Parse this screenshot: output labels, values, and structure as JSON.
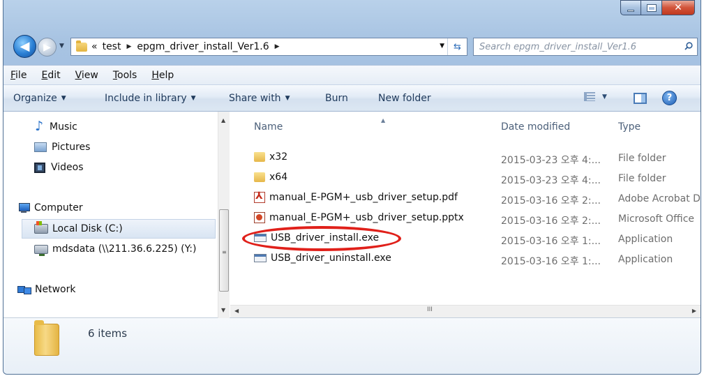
{
  "window": {
    "caption_minimize": "–",
    "caption_close": "✕"
  },
  "navigation": {
    "back_glyph": "◀",
    "forward_glyph": "▶",
    "address": {
      "overflow": "«",
      "crumbs": [
        "test",
        "epgm_driver_install_Ver1.6"
      ]
    },
    "search_placeholder": "Search epgm_driver_install_Ver1.6"
  },
  "menubar": {
    "items": [
      {
        "label": "File",
        "underline": "F",
        "rest": "ile"
      },
      {
        "label": "Edit",
        "underline": "E",
        "rest": "dit"
      },
      {
        "label": "View",
        "underline": "V",
        "rest": "iew"
      },
      {
        "label": "Tools",
        "underline": "T",
        "rest": "ools"
      },
      {
        "label": "Help",
        "underline": "H",
        "rest": "elp"
      }
    ]
  },
  "commandbar": {
    "organize": "Organize",
    "include_in_library": "Include in library",
    "share_with": "Share with",
    "burn": "Burn",
    "new_folder": "New folder",
    "help_glyph": "?"
  },
  "nav_pane": {
    "items": [
      {
        "label": "Music",
        "icon": "music-icon"
      },
      {
        "label": "Pictures",
        "icon": "pictures-icon"
      },
      {
        "label": "Videos",
        "icon": "videos-icon"
      },
      {
        "label": "Computer",
        "icon": "computer-icon"
      },
      {
        "label": "Local Disk (C:)",
        "icon": "local-disk-icon",
        "selected": true
      },
      {
        "label": "mdsdata (\\\\211.36.6.225) (Y:)",
        "icon": "network-drive-icon"
      },
      {
        "label": "Network",
        "icon": "network-icon"
      }
    ]
  },
  "file_list": {
    "columns": {
      "name": "Name",
      "date": "Date modified",
      "type": "Type"
    },
    "rows": [
      {
        "name": "x32",
        "date": "2015-03-23 오후 4:...",
        "type": "File folder",
        "icon": "folder-icon"
      },
      {
        "name": "x64",
        "date": "2015-03-23 오후 4:...",
        "type": "File folder",
        "icon": "folder-icon"
      },
      {
        "name": "manual_E-PGM+_usb_driver_setup.pdf",
        "date": "2015-03-16 오후 2:...",
        "type": "Adobe Acrobat D",
        "icon": "pdf-icon"
      },
      {
        "name": "manual_E-PGM+_usb_driver_setup.pptx",
        "date": "2015-03-16 오후 2:...",
        "type": "Microsoft Office",
        "icon": "pptx-icon"
      },
      {
        "name": "USB_driver_install.exe",
        "date": "2015-03-16 오후 1:...",
        "type": "Application",
        "icon": "exe-icon",
        "highlighted": true
      },
      {
        "name": "USB_driver_uninstall.exe",
        "date": "2015-03-16 오후 1:...",
        "type": "Application",
        "icon": "exe-icon"
      }
    ],
    "hscroll_grip": "III"
  },
  "details": {
    "item_count": "6 items"
  },
  "colors": {
    "highlight_ring": "#e0201a",
    "chrome": "#b9d1ea"
  }
}
